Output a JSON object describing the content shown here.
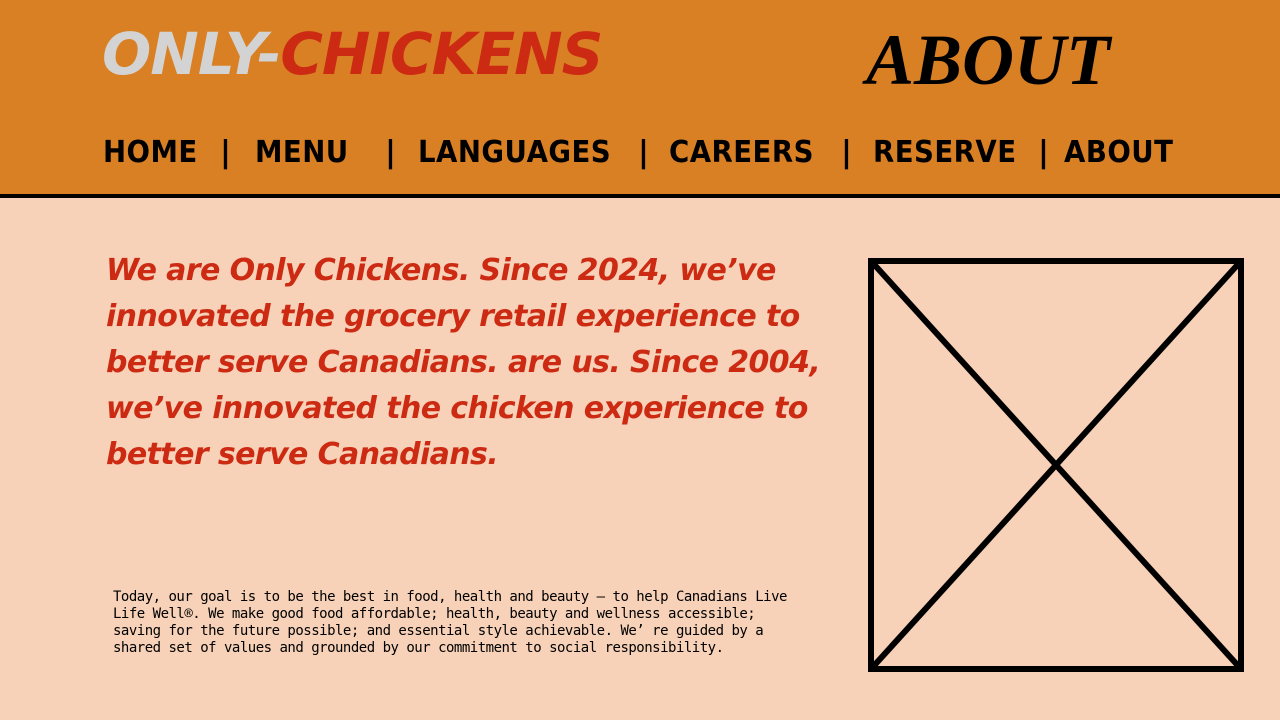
{
  "header": {
    "logo_part1": "ONLY-",
    "logo_part2": "CHICKENS",
    "page_title": "ABOUT"
  },
  "nav": {
    "items": [
      {
        "label": "HOME"
      },
      {
        "label": "MENU"
      },
      {
        "label": "LANGUAGES"
      },
      {
        "label": "CAREERS"
      },
      {
        "label": "RESERVE"
      },
      {
        "label": "ABOUT"
      }
    ],
    "separator": "|"
  },
  "main": {
    "intro": "We are Only Chickens. Since 2024, we’ve innovated the grocery retail experience to better serve Canadians. are us. Since 2004, we’ve innovated the  chicken experience to better serve Canadians.",
    "body": "Today, our goal is to be the best in food, health and beauty — to help Canadians Live Life Well®. We make good food affordable; health, beauty and wellness accessible; saving for the future possible; and essential style achievable. We’ re guided by a shared set of values and grounded by our commitment to social responsibility."
  },
  "colors": {
    "header_bg": "#d97f24",
    "page_bg": "#f7d2b8",
    "accent_red": "#cc2a12",
    "logo_gray": "#d3d3d3"
  },
  "icons": {
    "image_placeholder": "image-placeholder-icon"
  }
}
